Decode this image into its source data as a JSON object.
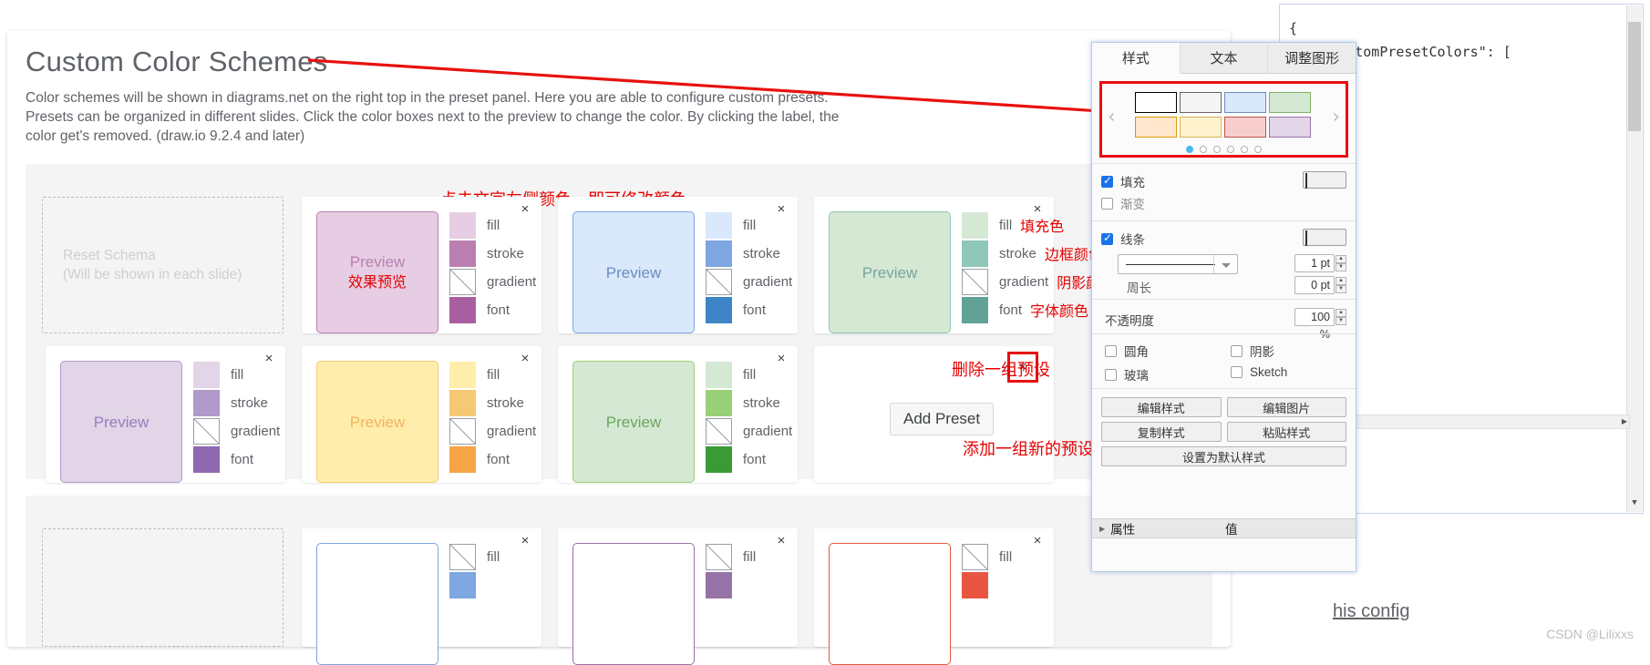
{
  "code_pane": {
    "line1": "{",
    "line2": "    \"customPresetColors\": ["
  },
  "page": {
    "title": "Custom Color Schemes",
    "intro": "Color schemes will be shown in diagrams.net on the right top in the preset panel. Here you are able to configure custom presets. Presets can be organized in different slides. Click the color boxes next to the preview to change the color. By clicking the label, the color get's removed. (draw.io 9.2.4 and later)",
    "close_label": "×",
    "reset_schema_line1": "Reset Schema",
    "reset_schema_line2": "(Will be shown in each slide)",
    "add_preset_label": "Add Preset",
    "preview_label": "Preview",
    "preview_label_cn": "效果预览",
    "row_labels": {
      "fill": "fill",
      "stroke": "stroke",
      "gradient": "gradient",
      "font": "font"
    },
    "annotations": {
      "click_color": "点击文字左侧颜色，即可修改颜色",
      "fill_cn": "填充色",
      "stroke_cn": "边框颜色",
      "gradient_cn": "阴影颜色",
      "font_cn": "字体颜色",
      "delete_preset": "删除一组预设",
      "add_preset": "添加一组新的预设"
    },
    "his_config": "his config",
    "watermark": "CSDN @Lilixxs"
  },
  "slides": [
    {
      "presets": [
        {
          "fill": "#e6cde3",
          "stroke": "#ba7fb0",
          "gradient": null,
          "font": "#a85fa0",
          "preview_text_color": "#ba7fb0",
          "cn_preview": true
        },
        {
          "fill": "#dae8fc",
          "stroke": "#7ea6e0",
          "gradient": null,
          "font": "#3d85c6",
          "preview_text_color": "#6c8ebf",
          "cn_preview": false
        },
        {
          "fill": "#d5e8d4",
          "stroke": "#8fc7b8",
          "gradient": null,
          "font": "#61a296",
          "preview_text_color": "#77a89c",
          "cn_preview": false,
          "cn_labels": true
        },
        {
          "fill": "#e1d5e7",
          "stroke": "#b09ac9",
          "gradient": null,
          "font": "#8e68b0",
          "preview_text_color": "#9a7cbf",
          "cn_preview": false
        },
        {
          "fill": "#ffeeab",
          "stroke": "#f7c873",
          "gradient": null,
          "font": "#f6a444",
          "preview_text_color": "#f2b263",
          "cn_preview": false
        },
        {
          "fill": "#d5e8d4",
          "stroke": "#97d077",
          "gradient": null,
          "font": "#3a9a35",
          "preview_text_color": "#6ba55f",
          "cn_preview": false
        }
      ]
    },
    {
      "presets": [
        {
          "fill": null,
          "stroke": "#7ea6e0",
          "gradient": null,
          "font": null,
          "preview_text_color": "#6c8ebf",
          "cn_preview": false
        },
        {
          "fill": null,
          "stroke": "#9673a6",
          "gradient": null,
          "font": null,
          "preview_text_color": "#9673a6",
          "cn_preview": false
        },
        {
          "fill": null,
          "stroke": "#e85642",
          "gradient": null,
          "font": null,
          "preview_text_color": "#e85642",
          "cn_preview": false
        }
      ]
    }
  ],
  "format_panel": {
    "tabs": [
      {
        "label": "样式",
        "active": true
      },
      {
        "label": "文本",
        "active": false
      },
      {
        "label": "调整图形",
        "active": false
      }
    ],
    "preset_strip": {
      "prev": "‹",
      "next": "›",
      "swatches": [
        {
          "fill": "#ffffff",
          "stroke": "#000000"
        },
        {
          "fill": "#f5f5f5",
          "stroke": "#666666"
        },
        {
          "fill": "#dae8fc",
          "stroke": "#6c8ebf"
        },
        {
          "fill": "#d5e8d4",
          "stroke": "#82b366"
        },
        {
          "fill": "#ffe6cc",
          "stroke": "#d79b00"
        },
        {
          "fill": "#fff2cc",
          "stroke": "#d6b656"
        },
        {
          "fill": "#f8cecc",
          "stroke": "#b85450"
        },
        {
          "fill": "#e1d5e7",
          "stroke": "#9673a6"
        }
      ],
      "dots": 6,
      "active_dot": 0
    },
    "fill": {
      "label": "填充",
      "checked": true,
      "color": "#ffffff"
    },
    "gradient": {
      "label": "渐变",
      "checked": false
    },
    "line": {
      "label": "线条",
      "checked": true,
      "color": "#000000",
      "width_value": "1 pt",
      "perimeter_label": "周长",
      "perimeter_value": "0 pt"
    },
    "opacity": {
      "label": "不透明度",
      "value": "100 %"
    },
    "checks": [
      {
        "label": "圆角",
        "checked": false
      },
      {
        "label": "阴影",
        "checked": false
      },
      {
        "label": "玻璃",
        "checked": false
      },
      {
        "label": "Sketch",
        "checked": false
      }
    ],
    "buttons": [
      "编辑样式",
      "编辑图片",
      "复制样式",
      "粘贴样式",
      "设置为默认样式"
    ],
    "property_header": {
      "name": "属性",
      "value": "值"
    }
  },
  "colors": {
    "accent_red": "#e8100f",
    "annotation_red": "#e60000",
    "link_blue": "#1a73e8"
  }
}
